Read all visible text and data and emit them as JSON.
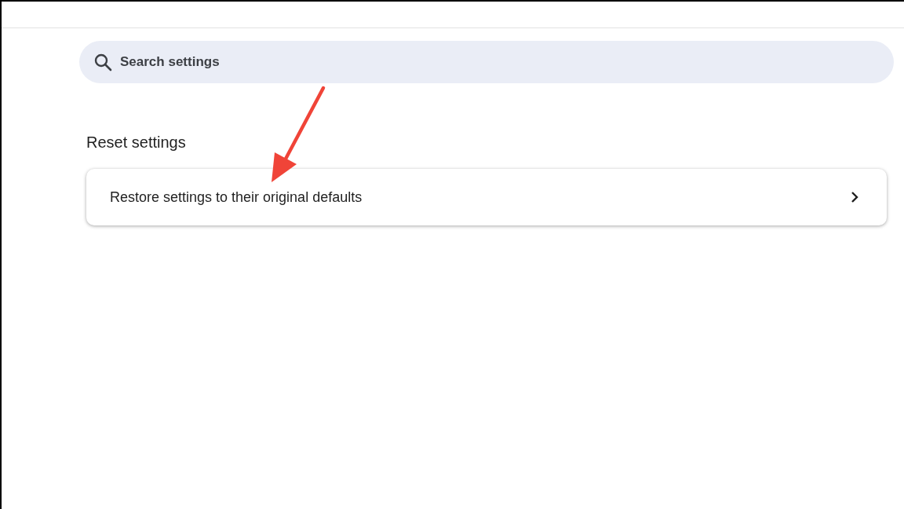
{
  "search": {
    "placeholder": "Search settings"
  },
  "section": {
    "title": "Reset settings",
    "items": [
      {
        "label": "Restore settings to their original defaults"
      }
    ]
  }
}
